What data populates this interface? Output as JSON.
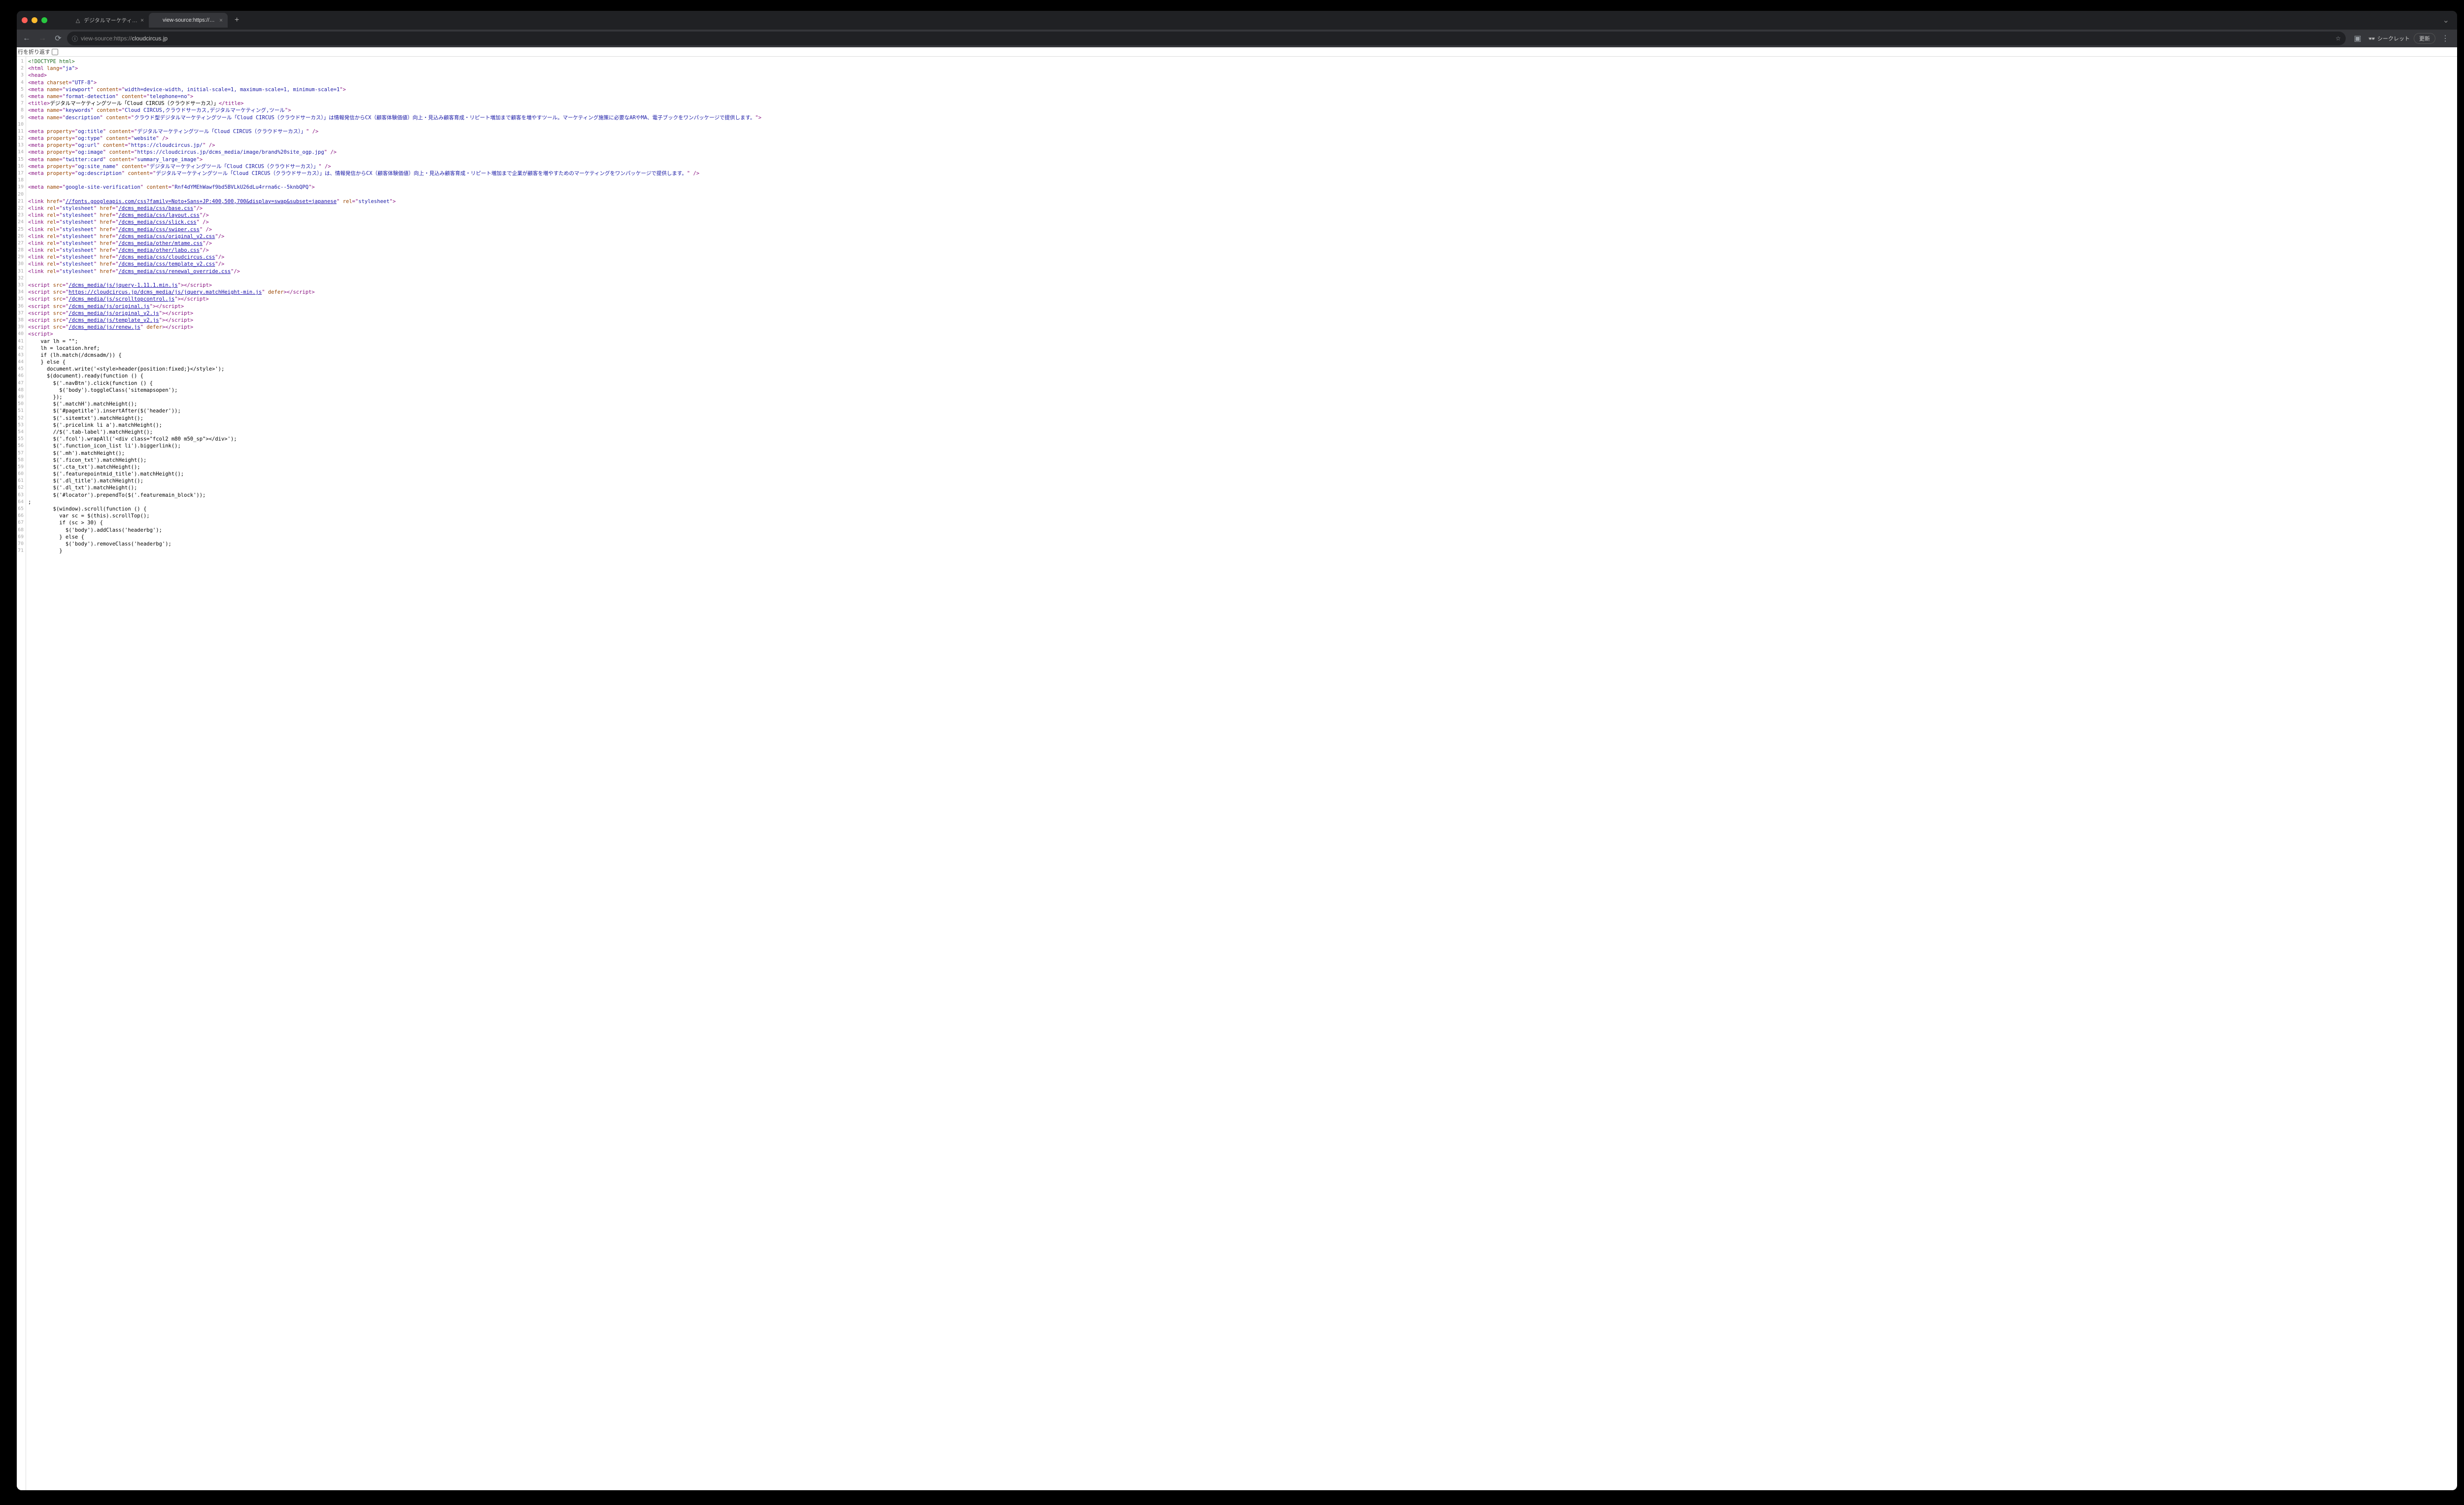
{
  "titlebar": {
    "tabs": [
      {
        "title": "デジタルマーケティングツール「C",
        "active": false,
        "favicon": "△"
      },
      {
        "title": "view-source:https://cloudcircu",
        "active": true,
        "favicon": ""
      }
    ],
    "newtab": "+"
  },
  "toolbar": {
    "address_prefix": "view-source:",
    "address_protocol": "https://",
    "address_host": "cloudcircus.jp",
    "incognito_label": "シークレット",
    "update_label": "更新"
  },
  "wrap": {
    "label": "行を折り返す"
  },
  "source": {
    "start_line": 1,
    "lines": [
      {
        "t": "comment",
        "c": "<!DOCTYPE html>"
      },
      {
        "t": "tag",
        "c": "<html lang=\"ja\">"
      },
      {
        "t": "tag",
        "c": "<head>"
      },
      {
        "t": "tag",
        "c": "<meta charset=\"UTF-8\">"
      },
      {
        "t": "meta",
        "name": "viewport",
        "content": "width=device-width, initial-scale=1, maximum-scale=1, minimum-scale=1"
      },
      {
        "t": "meta",
        "name": "format-detection",
        "content": "telephone=no"
      },
      {
        "t": "title",
        "text": "デジタルマーケティングツール「Cloud CIRCUS（クラウドサーカス）」"
      },
      {
        "t": "meta",
        "name": "keywords",
        "content": "Cloud CIRCUS,クラウドサーカス,デジタルマーケティング,ツール"
      },
      {
        "t": "meta",
        "name": "description",
        "content": "クラウド型デジタルマーケティングツール「Cloud CIRCUS（クラウドサーカス）」は情報発信からCX（顧客体験価値）向上・見込み顧客育成・リピート増加まで顧客を増やすツール。マーケティング施策に必要なARやMA、電子ブックをワンパッケージで提供します。"
      },
      {
        "t": "blank"
      },
      {
        "t": "metap",
        "prop": "og:title",
        "content": "デジタルマーケティングツール「Cloud CIRCUS（クラウドサーカス）」"
      },
      {
        "t": "metap",
        "prop": "og:type",
        "content": "website"
      },
      {
        "t": "metap",
        "prop": "og:url",
        "content": "https://cloudcircus.jp/"
      },
      {
        "t": "metap",
        "prop": "og:image",
        "content": "https://cloudcircus.jp/dcms_media/image/brand%20site_ogp.jpg"
      },
      {
        "t": "meta",
        "name": "twitter:card",
        "content": "summary_large_image"
      },
      {
        "t": "metap",
        "prop": "og:site_name",
        "content": "デジタルマーケティングツール「Cloud CIRCUS（クラウドサーカス）」"
      },
      {
        "t": "metap",
        "prop": "og:description",
        "content": "デジタルマーケティングツール「Cloud CIRCUS（クラウドサーカス）」は、情報発信からCX（顧客体験価値）向上・見込み顧客育成・リピート増加まで企業が顧客を増やすためのマーケティングをワンパッケージで提供します。"
      },
      {
        "t": "blank"
      },
      {
        "t": "meta",
        "name": "google-site-verification",
        "content": "Rnf4dYMEhWawf9bd5BVLkU26dLu4rrna6c--5knbQPQ"
      },
      {
        "t": "blank"
      },
      {
        "t": "linkhref",
        "href": "//fonts.googleapis.com/css?family=Noto+Sans+JP:400,500,700&display=swap&subset=japanese",
        "relafter": true
      },
      {
        "t": "linkrel",
        "href": "/dcms_media/css/base.css"
      },
      {
        "t": "linkrel",
        "href": "/dcms_media/css/layout.css"
      },
      {
        "t": "linkrel",
        "href": "/dcms_media/css/slick.css",
        "sp": true
      },
      {
        "t": "linkrel",
        "href": "/dcms_media/css/swiper.css",
        "sp": true
      },
      {
        "t": "linkrel",
        "href": "/dcms_media/css/original_v2.css"
      },
      {
        "t": "linkrel",
        "href": "/dcms_media/other/mtame.css"
      },
      {
        "t": "linkrel",
        "href": "/dcms_media/other/labo.css"
      },
      {
        "t": "linkrel",
        "href": "/dcms_media/css/cloudcircus.css"
      },
      {
        "t": "linkrel",
        "href": "/dcms_media/css/template_v2.css"
      },
      {
        "t": "linkrel",
        "href": "/dcms_media/css/renewal_override.css"
      },
      {
        "t": "blank"
      },
      {
        "t": "script",
        "src": "/dcms_media/js/jquery-1.11.1.min.js"
      },
      {
        "t": "script",
        "src": "https://cloudcircus.jp/dcms_media/js/jquery.matchHeight-min.js",
        "defer": true
      },
      {
        "t": "script",
        "src": "/dcms_media/js/scrolltopcontrol.js"
      },
      {
        "t": "script",
        "src": "/dcms_media/js/original.js"
      },
      {
        "t": "script",
        "src": "/dcms_media/js/original_v2.js"
      },
      {
        "t": "script",
        "src": "/dcms_media/js/template_v2.js"
      },
      {
        "t": "script",
        "src": "/dcms_media/js/renew.js",
        "defer": true
      },
      {
        "t": "tag",
        "c": "<script>"
      },
      {
        "t": "plain",
        "c": "    var lh = \"\";"
      },
      {
        "t": "plain",
        "c": "    lh = location.href;"
      },
      {
        "t": "plain",
        "c": "    if (lh.match(/dcmsadm/)) {"
      },
      {
        "t": "plain",
        "c": "    } else {"
      },
      {
        "t": "plain",
        "c": "      document.write('<style>header{position:fixed;}</style>');"
      },
      {
        "t": "plain",
        "c": "      $(document).ready(function () {"
      },
      {
        "t": "plain",
        "c": "        $('.navBtn').click(function () {"
      },
      {
        "t": "plain",
        "c": "          $('body').toggleClass('sitemapsopen');"
      },
      {
        "t": "plain",
        "c": "        });"
      },
      {
        "t": "plain",
        "c": "        $('.matchH').matchHeight();"
      },
      {
        "t": "plain",
        "c": "        $('#pagetitle').insertAfter($('header'));"
      },
      {
        "t": "plain",
        "c": "        $('.sitemtxt').matchHeight();"
      },
      {
        "t": "plain",
        "c": "        $('.pricelink li a').matchHeight();"
      },
      {
        "t": "plain",
        "c": "        //$('.tab-label').matchHeight();"
      },
      {
        "t": "plain",
        "c": "        $('.fcol').wrapAll('<div class=\"fcol2 m80 m50_sp\"></div>');"
      },
      {
        "t": "plain",
        "c": "        $('.function_icon_list li').biggerlink();"
      },
      {
        "t": "plain",
        "c": "        $('.mh').matchHeight();"
      },
      {
        "t": "plain",
        "c": "        $('.ficon_txt').matchHeight();"
      },
      {
        "t": "plain",
        "c": "        $('.cta_txt').matchHeight();"
      },
      {
        "t": "plain",
        "c": "        $('.featurepointmid_title').matchHeight();"
      },
      {
        "t": "plain",
        "c": "        $('.dl_title').matchHeight();"
      },
      {
        "t": "plain",
        "c": "        $('.dl_txt').matchHeight();"
      },
      {
        "t": "plain",
        "c": "        $('#locator').prependTo($('.featuremain_block'));"
      },
      {
        "t": "blank2"
      },
      {
        "t": "plain",
        "c": "        $(window).scroll(function () {"
      },
      {
        "t": "plain",
        "c": "          var sc = $(this).scrollTop();"
      },
      {
        "t": "plain",
        "c": "          if (sc > 30) {"
      },
      {
        "t": "plain",
        "c": "            $('body').addClass('headerbg');"
      },
      {
        "t": "plain",
        "c": "          } else {"
      },
      {
        "t": "plain",
        "c": "            $('body').removeClass('headerbg');"
      },
      {
        "t": "plain",
        "c": "          }"
      }
    ]
  }
}
